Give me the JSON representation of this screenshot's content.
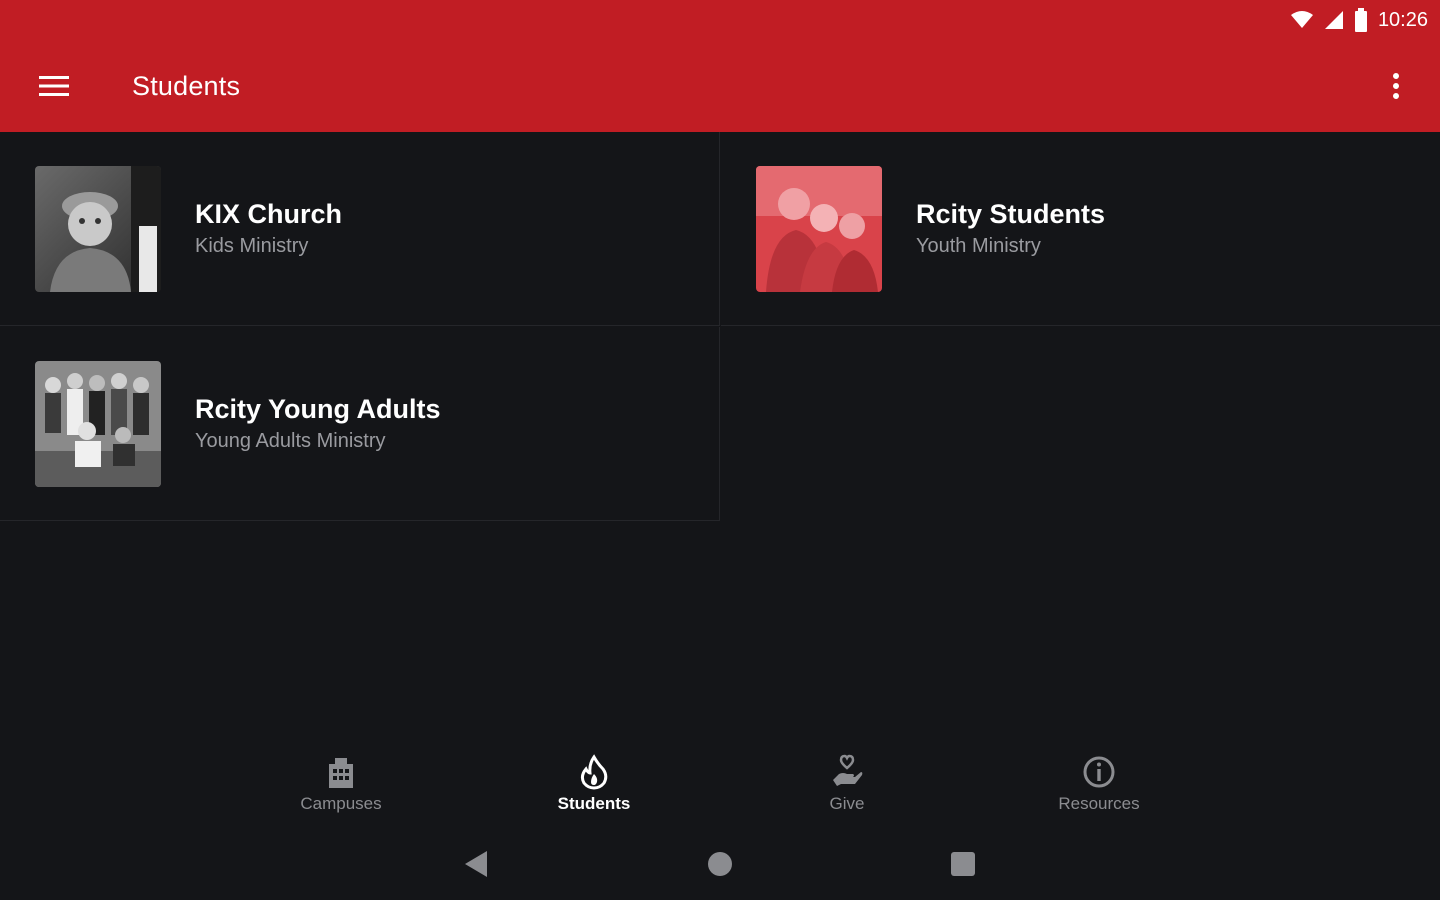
{
  "status_bar": {
    "time": "10:26",
    "icons": [
      "wifi-icon",
      "signal-icon",
      "battery-icon"
    ]
  },
  "app_bar": {
    "title": "Students",
    "background": "#c11d24"
  },
  "ministries": [
    {
      "title": "KIX Church",
      "subtitle": "Kids Ministry",
      "image_tint": "grayscale"
    },
    {
      "title": "Rcity Students",
      "subtitle": "Youth Ministry",
      "image_tint": "red"
    },
    {
      "title": "Rcity Young Adults",
      "subtitle": "Young Adults Ministry",
      "image_tint": "grayscale"
    }
  ],
  "bottom_nav": {
    "active": "Students",
    "items": [
      {
        "label": "Campuses",
        "icon": "building-icon"
      },
      {
        "label": "Students",
        "icon": "flame-icon"
      },
      {
        "label": "Give",
        "icon": "hand-heart-icon"
      },
      {
        "label": "Resources",
        "icon": "info-icon"
      }
    ]
  },
  "system_nav": {
    "icons": [
      "back-icon",
      "home-icon",
      "recents-icon"
    ]
  }
}
